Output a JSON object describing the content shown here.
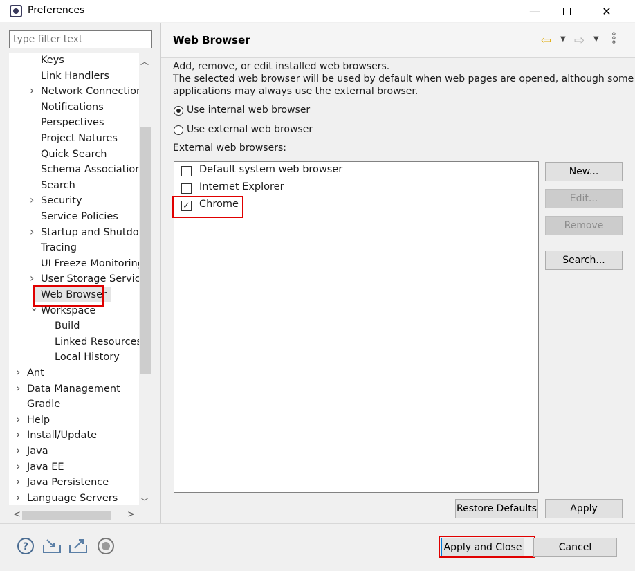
{
  "window": {
    "title": "Preferences",
    "min_glyph": "—",
    "close_glyph": "✕"
  },
  "filter": {
    "placeholder": "type filter text"
  },
  "tree": {
    "items": [
      {
        "label": "Keys",
        "expander": ""
      },
      {
        "label": "Link Handlers",
        "expander": ""
      },
      {
        "label": "Network Connections",
        "expander": ">"
      },
      {
        "label": "Notifications",
        "expander": ""
      },
      {
        "label": "Perspectives",
        "expander": ""
      },
      {
        "label": "Project Natures",
        "expander": ""
      },
      {
        "label": "Quick Search",
        "expander": ""
      },
      {
        "label": "Schema Associations",
        "expander": ""
      },
      {
        "label": "Search",
        "expander": ""
      },
      {
        "label": "Security",
        "expander": ">"
      },
      {
        "label": "Service Policies",
        "expander": ""
      },
      {
        "label": "Startup and Shutdown",
        "expander": ">"
      },
      {
        "label": "Tracing",
        "expander": ""
      },
      {
        "label": "UI Freeze Monitoring",
        "expander": ""
      },
      {
        "label": "User Storage Service",
        "expander": ">"
      },
      {
        "label": "Web Browser",
        "expander": ""
      },
      {
        "label": "Workspace",
        "expander": "v"
      },
      {
        "label": "Build",
        "expander": ""
      },
      {
        "label": "Linked Resources",
        "expander": ""
      },
      {
        "label": "Local History",
        "expander": ""
      },
      {
        "label": "Ant",
        "expander": ">"
      },
      {
        "label": "Data Management",
        "expander": ">"
      },
      {
        "label": "Gradle",
        "expander": ""
      },
      {
        "label": "Help",
        "expander": ">"
      },
      {
        "label": "Install/Update",
        "expander": ">"
      },
      {
        "label": "Java",
        "expander": ">"
      },
      {
        "label": "Java EE",
        "expander": ">"
      },
      {
        "label": "Java Persistence",
        "expander": ">"
      },
      {
        "label": "Language Servers",
        "expander": ">"
      }
    ],
    "selected": "Web Browser"
  },
  "page": {
    "title": "Web Browser",
    "desc_line1": "Add, remove, or edit installed web browsers.",
    "desc_line2": "The selected web browser will be used by default when web pages are opened, although some",
    "desc_line3": "applications may always use the external browser.",
    "radio_internal": "Use internal web browser",
    "radio_external": "Use external web browser",
    "selected_mode": "internal",
    "list_label": "External web browsers:",
    "browsers": [
      {
        "label": "Default system web browser",
        "checked": false,
        "mark": ""
      },
      {
        "label": "Internet Explorer",
        "checked": false,
        "mark": ""
      },
      {
        "label": "Chrome",
        "checked": true,
        "mark": "✓"
      }
    ],
    "buttons": {
      "new": "New...",
      "edit": "Edit...",
      "remove": "Remove",
      "search": "Search..."
    },
    "restore_defaults": "Restore Defaults",
    "apply": "Apply"
  },
  "footer": {
    "apply_close": "Apply and Close",
    "cancel": "Cancel"
  },
  "highlight_color": "#e00000"
}
